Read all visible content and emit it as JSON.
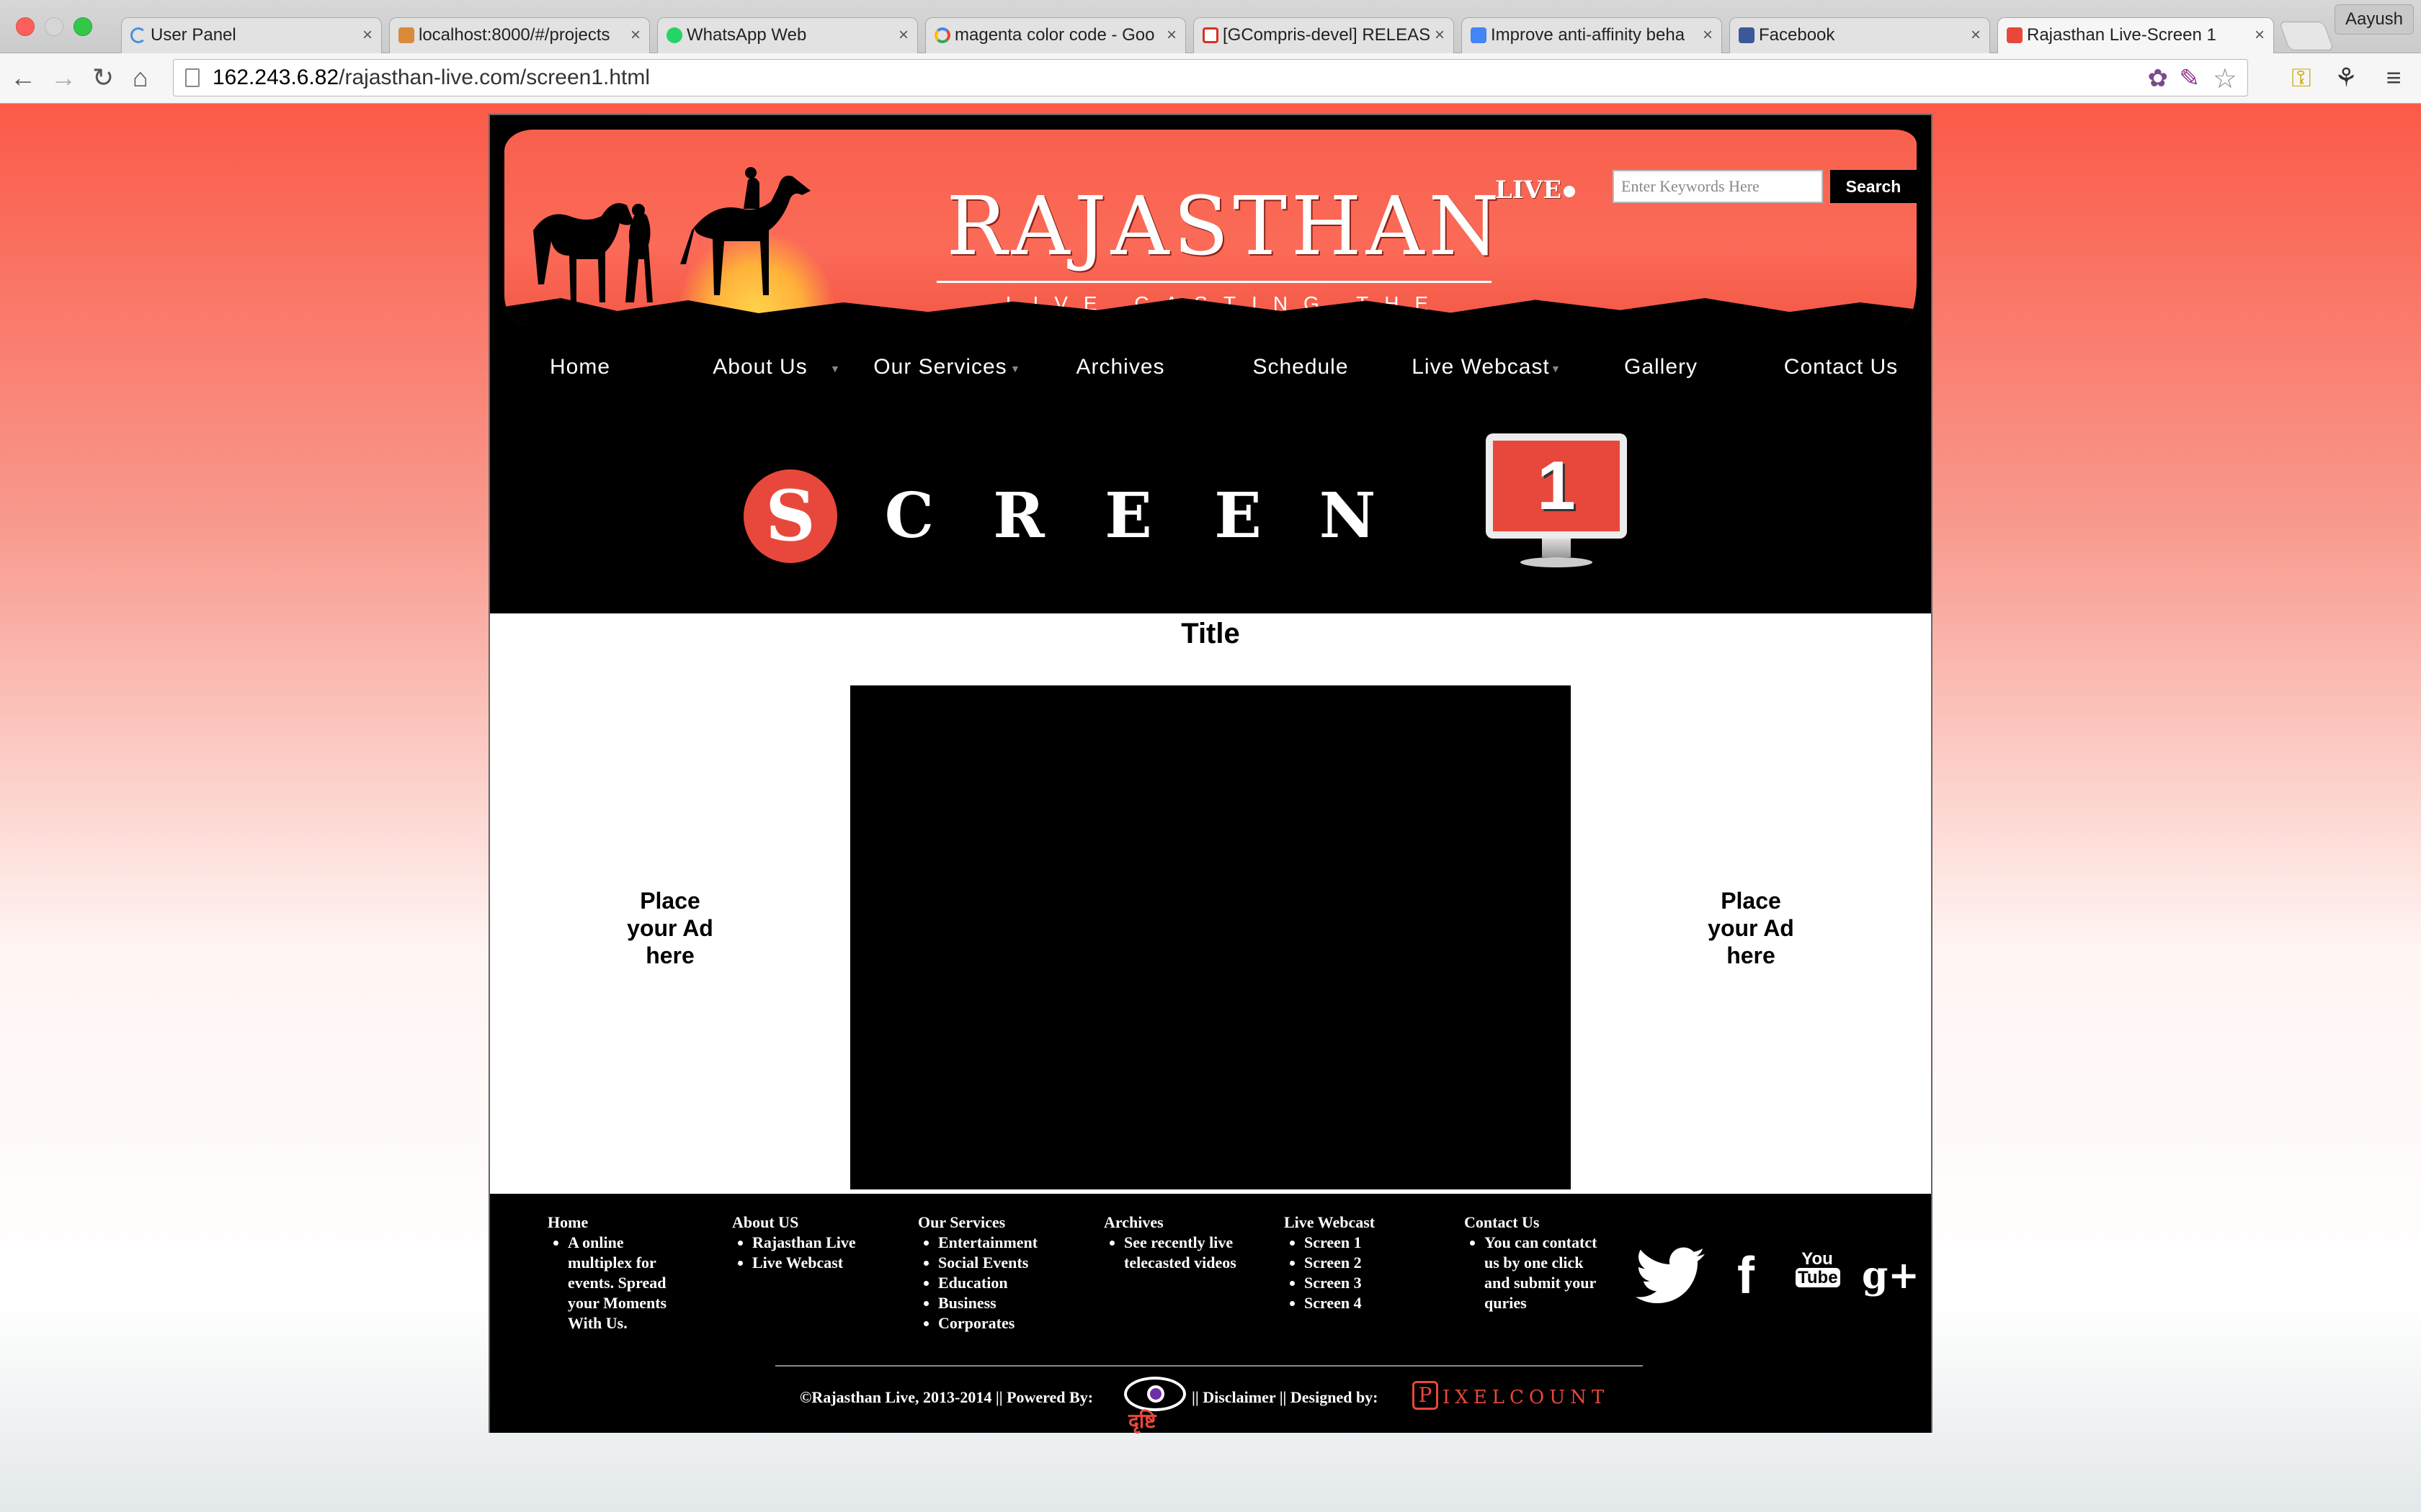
{
  "browser": {
    "tabs": [
      {
        "title": "User Panel",
        "favicon": "loading-spinner-icon"
      },
      {
        "title": "localhost:8000/#/projects",
        "favicon": "cake-icon"
      },
      {
        "title": "WhatsApp Web",
        "favicon": "whatsapp-icon"
      },
      {
        "title": "magenta color code - Goo",
        "favicon": "google-icon"
      },
      {
        "title": "[GCompris-devel] RELEAS",
        "favicon": "gmail-icon"
      },
      {
        "title": "Improve anti-affinity beha",
        "favicon": "docs-icon"
      },
      {
        "title": "Facebook",
        "favicon": "facebook-icon"
      },
      {
        "title": "Rajasthan Live-Screen 1",
        "favicon": "rajasthan-icon",
        "active": true
      }
    ],
    "profile_name": "Aayush",
    "url_host": "162.243.6.82",
    "url_path": "/rajasthan-live.com/screen1.html"
  },
  "site": {
    "title": "RAJASTHAN",
    "live_badge": "LIVE",
    "tagline": "LIVE CASTING THE EVENTS",
    "search": {
      "placeholder": "Enter Keywords Here",
      "button": "Search"
    },
    "nav": [
      "Home",
      "About Us",
      "Our Services",
      "Archives",
      "Schedule",
      "Live Webcast",
      "Gallery",
      "Contact Us"
    ],
    "hero": {
      "first_letter": "S",
      "letters": [
        "C",
        "R",
        "E",
        "E",
        "N"
      ],
      "number": "1"
    },
    "content_title": "Title",
    "ad_left": "Place your Ad here",
    "ad_right": "Place your Ad here",
    "footer": {
      "columns": [
        {
          "heading": "Home",
          "items": [
            "A online multiplex for events. Spread your Moments With Us."
          ]
        },
        {
          "heading": "About US",
          "items": [
            "Rajasthan Live",
            "Live Webcast"
          ]
        },
        {
          "heading": "Our Services",
          "items": [
            "Entertainment",
            "Social Events",
            "Education",
            "Business",
            "Corporates"
          ]
        },
        {
          "heading": "Archives",
          "items": [
            "See recently live telecasted videos"
          ]
        },
        {
          "heading": "Live Webcast",
          "items": [
            "Screen 1",
            "Screen 2",
            "Screen 3",
            "Screen 4"
          ]
        },
        {
          "heading": "Contact Us",
          "items": [
            "You can contatct us by one click and submit your quries"
          ]
        }
      ],
      "social": [
        "twitter-icon",
        "facebook-icon",
        "youtube-icon",
        "google-plus-icon"
      ],
      "social_labels": {
        "facebook": "f",
        "youtube_top": "You",
        "youtube_bottom": "Tube",
        "gplus": "g+"
      },
      "copyright": "©Rajasthan Live, 2013-2014 || Powered By:",
      "powered_by_logo_text": "दृष्टि",
      "disclaimer": "|| Disclaimer || Designed by:",
      "designer_logo_initial": "P",
      "designer_logo_rest": "IXELCOUNT"
    }
  },
  "colors": {
    "accent": "#e8483b",
    "banner": "#fb6b58",
    "page_top": "#fb5a48"
  }
}
